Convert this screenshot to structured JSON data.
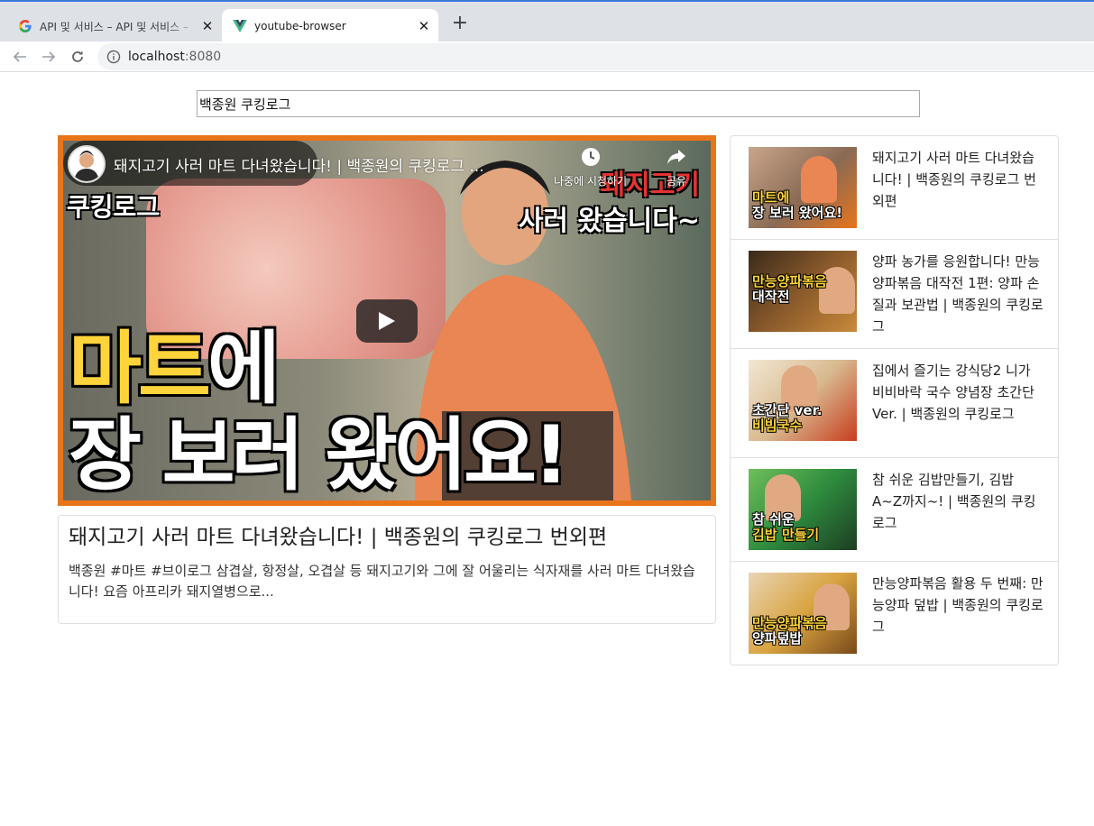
{
  "browser": {
    "tabs": [
      {
        "title": "API 및 서비스 – API 및 서비스 – ",
        "active": false,
        "icon": "google-g-icon"
      },
      {
        "title": "youtube-browser",
        "active": true,
        "icon": "vue-icon"
      }
    ],
    "address": {
      "host": "localhost",
      "port": ":8080"
    }
  },
  "search": {
    "value": "백종원 쿠킹로그"
  },
  "player": {
    "title": "돼지고기 사러 마트 다녀왔습니다! | 백종원의 쿠킹로그 ...",
    "actions": [
      {
        "label": "나중에 시청하기",
        "icon": "clock-icon"
      },
      {
        "label": "공유",
        "icon": "share-icon"
      }
    ],
    "thumbnail_text": {
      "brand": "쿠킹로그",
      "side_line1": "돼지고기",
      "side_line2": "사러 왔습니다~",
      "headline_line1_a": "마트",
      "headline_line1_b": "에",
      "headline_line2": "장 보러 왔어요!"
    }
  },
  "detail": {
    "title": "돼지고기 사러 마트 다녀왔습니다! | 백종원의 쿠킹로그 번외편",
    "description": "백종원 #마트 #브이로그 삼겹살, 항정살, 오겹살 등 돼지고기와 그에 잘 어울리는 식자재를 사러 마트 다녀왔습니다! 요즘 아프리카 돼지열병으로..."
  },
  "videos": [
    {
      "title": "돼지고기 사러 마트 다녀왔습니다! | 백종원의 쿠킹로그 번외편",
      "thumb_label": [
        "마트에",
        "장 보러 왔어요!"
      ],
      "accent": "#e8751a"
    },
    {
      "title": "양파 농가를 응원합니다! 만능양파볶음 대작전 1편: 양파 손질과 보관법 | 백종원의 쿠킹로그",
      "thumb_label": [
        "만능양파볶음",
        "대작전"
      ],
      "accent": "#8a5a2b"
    },
    {
      "title": "집에서 즐기는 강식당2 니가 비비바락 국수 양념장 초간단 Ver. | 백종원의 쿠킹로그",
      "thumb_label": [
        "초간단 ver.",
        "비빔국수"
      ],
      "accent": "#c83c1e"
    },
    {
      "title": "참 쉬운 김밥만들기, 김밥 A~Z까지~! | 백종원의 쿠킹로그",
      "thumb_label": [
        "참 쉬운",
        "김밥 만들기"
      ],
      "accent": "#2e8b3e"
    },
    {
      "title": "만능양파볶음 활용 두 번째: 만능양파 덮밥 | 백종원의 쿠킹로그",
      "thumb_label": [
        "만능양파볶음",
        "양파덮밥"
      ],
      "accent": "#d9a441"
    }
  ]
}
